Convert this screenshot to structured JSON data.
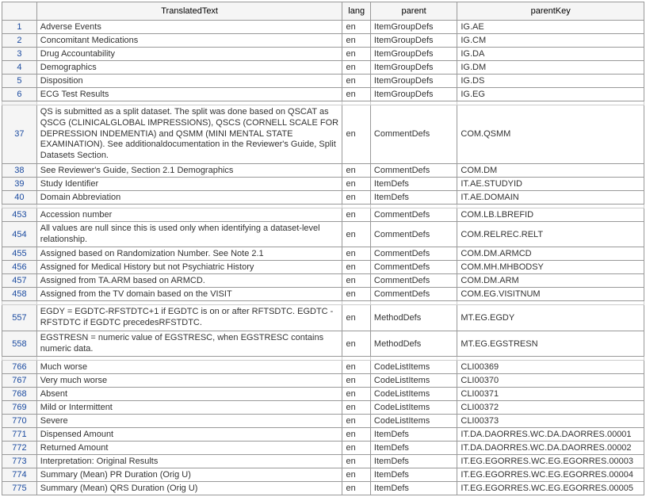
{
  "headers": {
    "rownum": "",
    "text": "TranslatedText",
    "lang": "lang",
    "parent": "parent",
    "parentKey": "parentKey"
  },
  "groups": [
    {
      "rows": [
        {
          "n": "1",
          "text": "Adverse Events",
          "lang": "en",
          "parent": "ItemGroupDefs",
          "pkey": "IG.AE"
        },
        {
          "n": "2",
          "text": "Concomitant Medications",
          "lang": "en",
          "parent": "ItemGroupDefs",
          "pkey": "IG.CM"
        },
        {
          "n": "3",
          "text": "Drug Accountability",
          "lang": "en",
          "parent": "ItemGroupDefs",
          "pkey": "IG.DA"
        },
        {
          "n": "4",
          "text": "Demographics",
          "lang": "en",
          "parent": "ItemGroupDefs",
          "pkey": "IG.DM"
        },
        {
          "n": "5",
          "text": "Disposition",
          "lang": "en",
          "parent": "ItemGroupDefs",
          "pkey": "IG.DS"
        },
        {
          "n": "6",
          "text": "ECG Test Results",
          "lang": "en",
          "parent": "ItemGroupDefs",
          "pkey": "IG.EG"
        }
      ]
    },
    {
      "rows": [
        {
          "n": "37",
          "text": "QS is submitted as a split dataset. The split was done based on QSCAT as QSCG (CLINICALGLOBAL IMPRESSIONS), QSCS (CORNELL SCALE FOR DEPRESSION INDEMENTIA) and QSMM (MINI MENTAL STATE EXAMINATION). See additionaldocumentation in the Reviewer's Guide, Split Datasets Section.",
          "lang": "en",
          "parent": "CommentDefs",
          "pkey": "COM.QSMM",
          "tall": true
        },
        {
          "n": "38",
          "text": "See Reviewer's Guide, Section 2.1 Demographics",
          "lang": "en",
          "parent": "CommentDefs",
          "pkey": "COM.DM"
        },
        {
          "n": "39",
          "text": "Study Identifier",
          "lang": "en",
          "parent": "ItemDefs",
          "pkey": "IT.AE.STUDYID"
        },
        {
          "n": "40",
          "text": "Domain Abbreviation",
          "lang": "en",
          "parent": "ItemDefs",
          "pkey": "IT.AE.DOMAIN"
        }
      ]
    },
    {
      "rows": [
        {
          "n": "453",
          "text": "Accession number",
          "lang": "en",
          "parent": "CommentDefs",
          "pkey": "COM.LB.LBREFID"
        },
        {
          "n": "454",
          "text": "All values are null since this is used only when identifying a dataset-level relationship.",
          "lang": "en",
          "parent": "CommentDefs",
          "pkey": "COM.RELREC.RELT",
          "tall": true
        },
        {
          "n": "455",
          "text": "Assigned based on Randomization Number. See Note 2.1",
          "lang": "en",
          "parent": "CommentDefs",
          "pkey": "COM.DM.ARMCD"
        },
        {
          "n": "456",
          "text": "Assigned for Medical History but not Psychiatric History",
          "lang": "en",
          "parent": "CommentDefs",
          "pkey": "COM.MH.MHBODSY"
        },
        {
          "n": "457",
          "text": "Assigned from TA.ARM based on ARMCD.",
          "lang": "en",
          "parent": "CommentDefs",
          "pkey": "COM.DM.ARM"
        },
        {
          "n": "458",
          "text": "Assigned from the TV domain based on the VISIT",
          "lang": "en",
          "parent": "CommentDefs",
          "pkey": "COM.EG.VISITNUM"
        }
      ]
    },
    {
      "rows": [
        {
          "n": "557",
          "text": "EGDY = EGDTC-RFSTDTC+1 if EGDTC is on or after RFTSDTC. EGDTC - RFSTDTC if EGDTC precedesRFSTDTC.",
          "lang": "en",
          "parent": "MethodDefs",
          "pkey": "MT.EG.EGDY",
          "tall": true
        },
        {
          "n": "558",
          "text": "EGSTRESN = numeric value of EGSTRESC, when EGSTRESC contains numeric data.",
          "lang": "en",
          "parent": "MethodDefs",
          "pkey": "MT.EG.EGSTRESN",
          "tall": true
        }
      ]
    },
    {
      "rows": [
        {
          "n": "766",
          "text": "Much worse",
          "lang": "en",
          "parent": "CodeListItems",
          "pkey": "CLI00369"
        },
        {
          "n": "767",
          "text": "Very much worse",
          "lang": "en",
          "parent": "CodeListItems",
          "pkey": "CLI00370"
        },
        {
          "n": "768",
          "text": "Absent",
          "lang": "en",
          "parent": "CodeListItems",
          "pkey": "CLI00371"
        },
        {
          "n": "769",
          "text": "Mild or Intermittent",
          "lang": "en",
          "parent": "CodeListItems",
          "pkey": "CLI00372"
        },
        {
          "n": "770",
          "text": "Severe",
          "lang": "en",
          "parent": "CodeListItems",
          "pkey": "CLI00373"
        },
        {
          "n": "771",
          "text": "Dispensed Amount",
          "lang": "en",
          "parent": "ItemDefs",
          "pkey": "IT.DA.DAORRES.WC.DA.DAORRES.00001"
        },
        {
          "n": "772",
          "text": "Returned Amount",
          "lang": "en",
          "parent": "ItemDefs",
          "pkey": "IT.DA.DAORRES.WC.DA.DAORRES.00002"
        },
        {
          "n": "773",
          "text": "Interpretation: Original Results",
          "lang": "en",
          "parent": "ItemDefs",
          "pkey": "IT.EG.EGORRES.WC.EG.EGORRES.00003"
        },
        {
          "n": "774",
          "text": "Summary (Mean) PR Duration (Orig U)",
          "lang": "en",
          "parent": "ItemDefs",
          "pkey": "IT.EG.EGORRES.WC.EG.EGORRES.00004"
        },
        {
          "n": "775",
          "text": "Summary (Mean) QRS Duration (Orig U)",
          "lang": "en",
          "parent": "ItemDefs",
          "pkey": "IT.EG.EGORRES.WC.EG.EGORRES.00005"
        }
      ]
    }
  ]
}
